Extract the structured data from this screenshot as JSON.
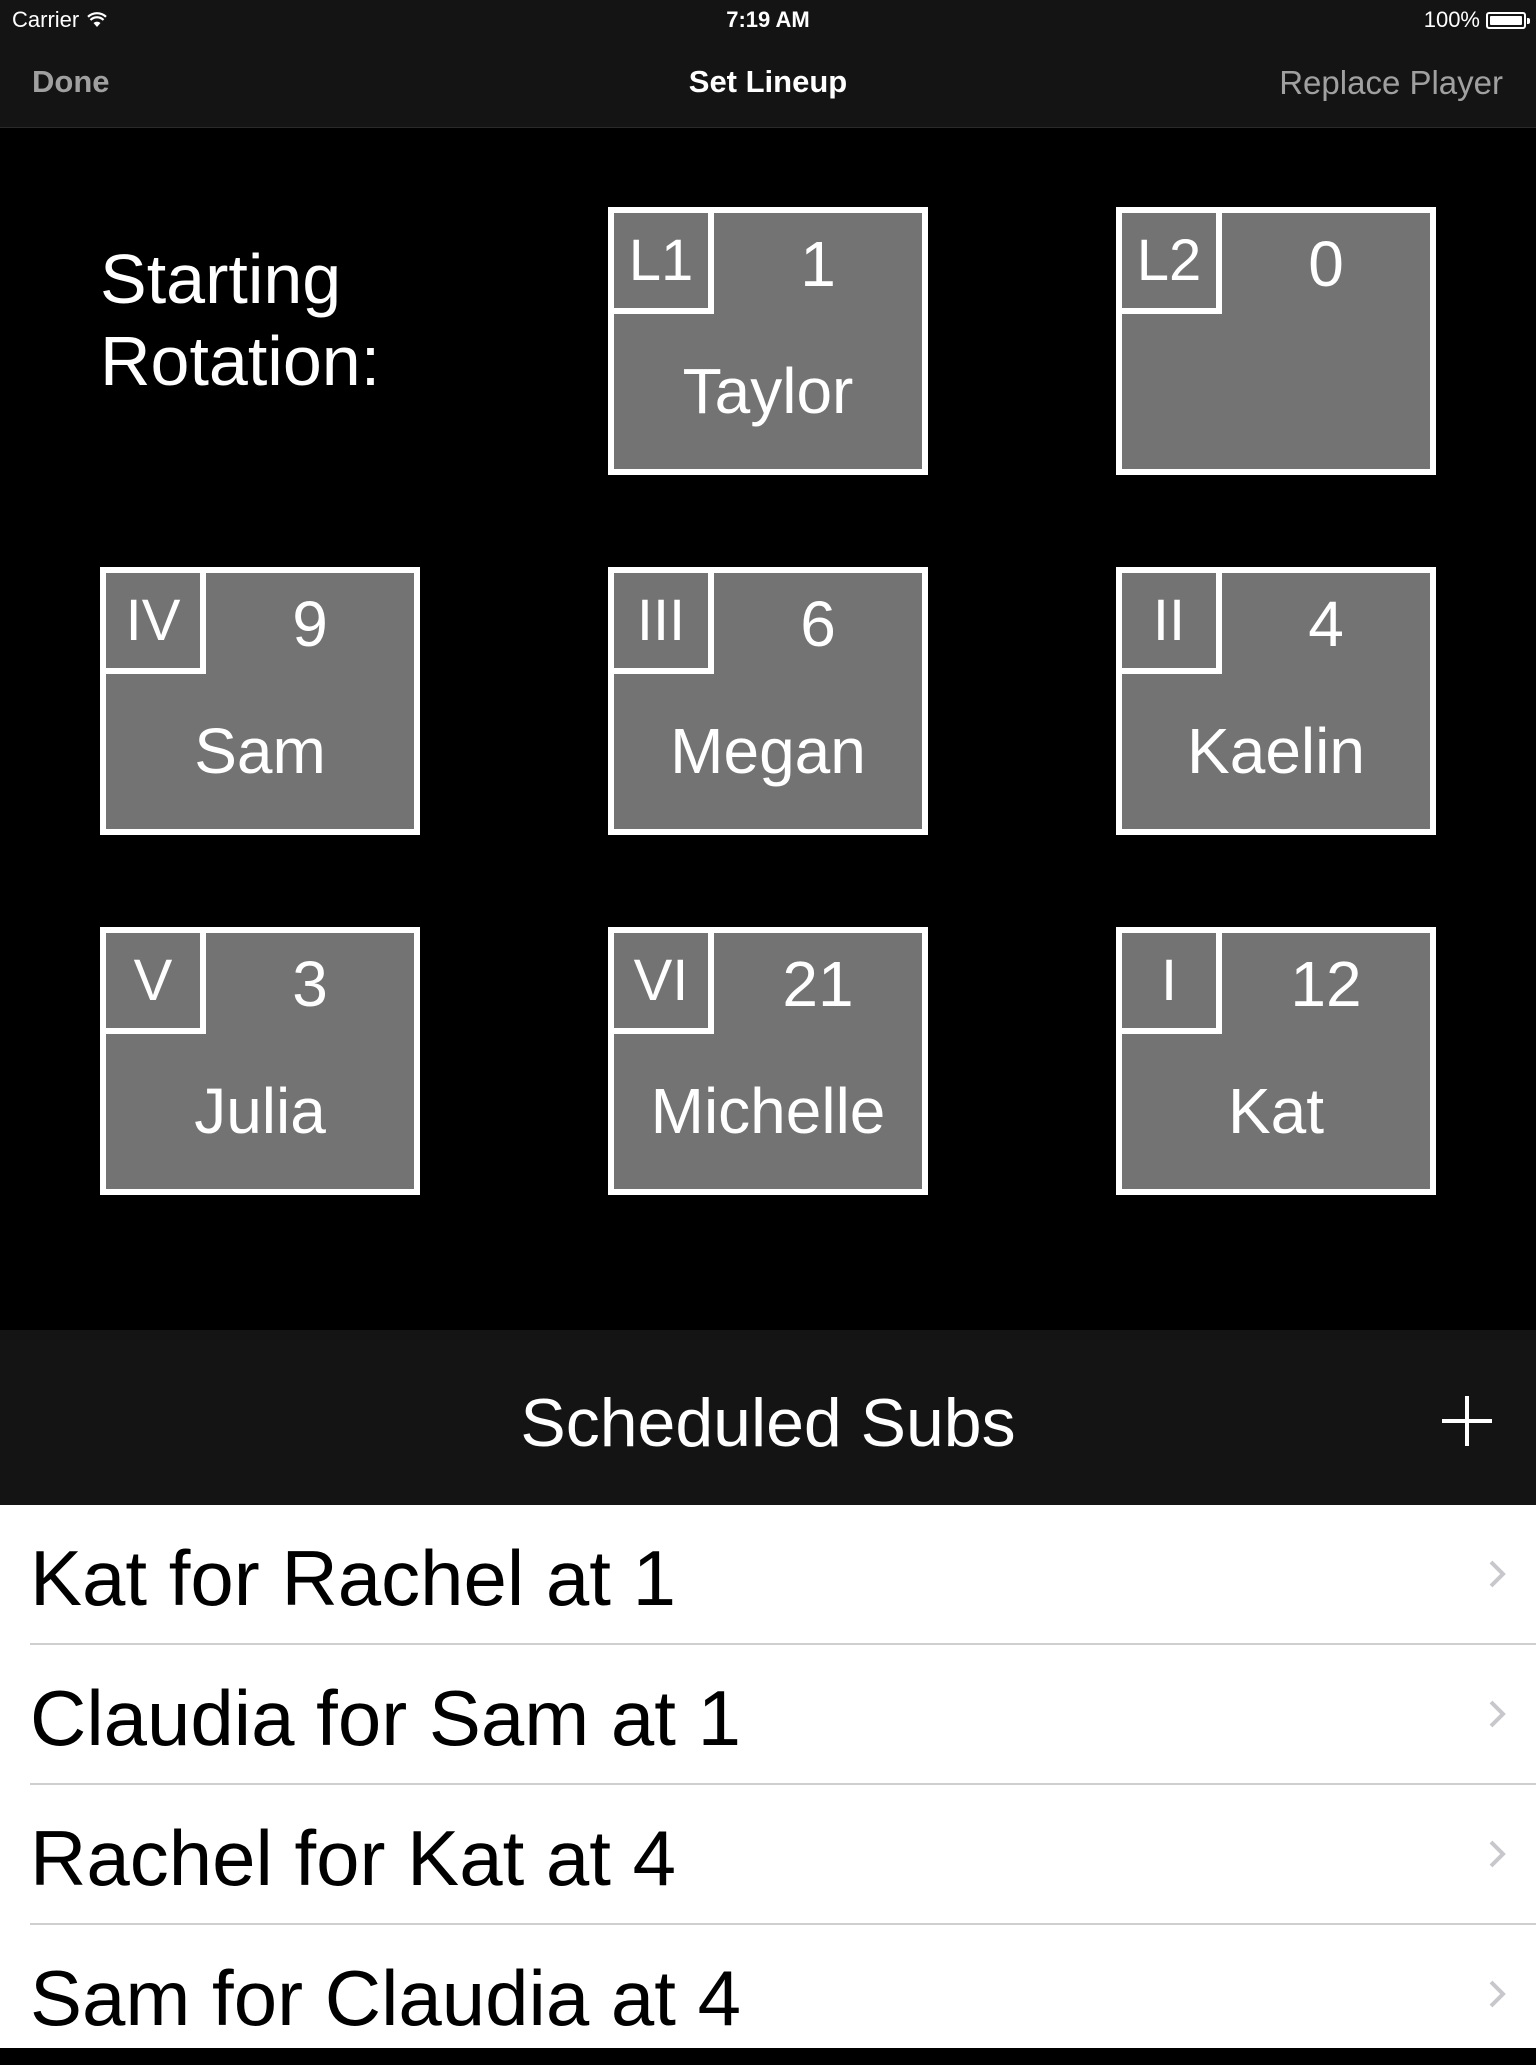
{
  "status_bar": {
    "carrier": "Carrier",
    "wifi_icon": "wifi-icon",
    "time": "7:19 AM",
    "battery_percent": "100%",
    "battery_level": 1.0
  },
  "nav": {
    "left_button": "Done",
    "title": "Set Lineup",
    "right_button": "Replace Player"
  },
  "rotation": {
    "label_line1": "Starting",
    "label_line2": "Rotation:",
    "tiles": [
      {
        "position": "L1",
        "number": "1",
        "name": "Taylor"
      },
      {
        "position": "L2",
        "number": "0",
        "name": ""
      },
      {
        "position": "IV",
        "number": "9",
        "name": "Sam"
      },
      {
        "position": "III",
        "number": "6",
        "name": "Megan"
      },
      {
        "position": "II",
        "number": "4",
        "name": "Kaelin"
      },
      {
        "position": "V",
        "number": "3",
        "name": "Julia"
      },
      {
        "position": "VI",
        "number": "21",
        "name": "Michelle"
      },
      {
        "position": "I",
        "number": "12",
        "name": "Kat"
      }
    ]
  },
  "subs": {
    "title": "Scheduled Subs",
    "add_icon": "plus-icon",
    "items": [
      {
        "label": "Kat for Rachel at 1"
      },
      {
        "label": "Claudia for Sam at 1"
      },
      {
        "label": "Rachel for Kat at 4"
      },
      {
        "label": "Sam for Claudia at 4"
      }
    ],
    "row_icon": "chevron-right-icon"
  },
  "colors": {
    "bar_background": "#141414",
    "tile_fill": "#737373",
    "tile_border": "#ffffff",
    "nav_button": "#a0a0a0",
    "chevron": "#c7c7cc",
    "divider": "#cfcfcf"
  }
}
